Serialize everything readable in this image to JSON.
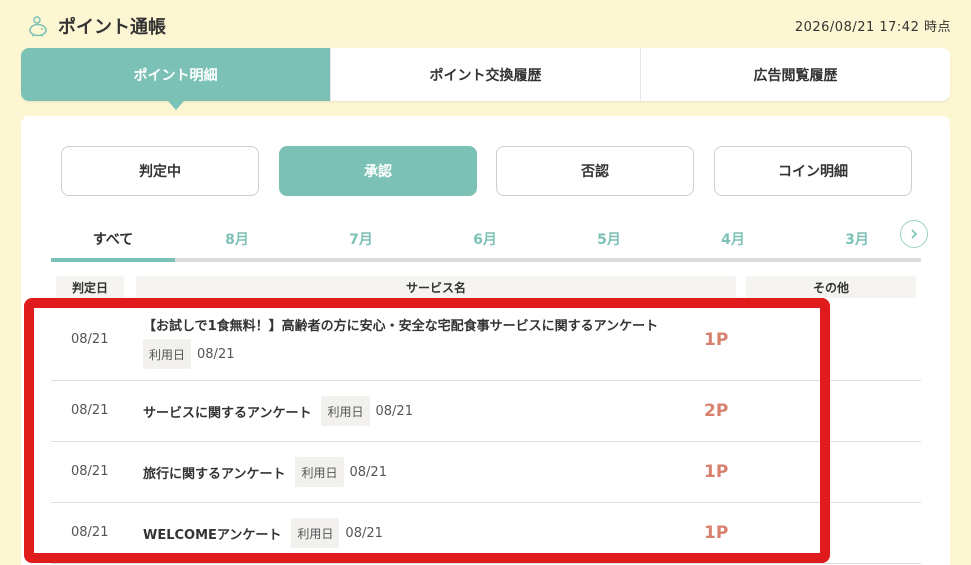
{
  "header": {
    "title": "ポイント通帳",
    "icon": "piggy-bank-icon",
    "timestamp": "2026/08/21 17:42 時点"
  },
  "main_tabs": [
    {
      "label": "ポイント明細",
      "active": true
    },
    {
      "label": "ポイント交換履歴",
      "active": false
    },
    {
      "label": "広告閲覧履歴",
      "active": false
    }
  ],
  "filters": [
    {
      "label": "判定中",
      "active": false
    },
    {
      "label": "承認",
      "active": true
    },
    {
      "label": "否認",
      "active": false
    },
    {
      "label": "コイン明細",
      "active": false
    }
  ],
  "months": [
    {
      "label": "すべて",
      "active": true
    },
    {
      "label": "8月",
      "active": false
    },
    {
      "label": "7月",
      "active": false
    },
    {
      "label": "6月",
      "active": false
    },
    {
      "label": "5月",
      "active": false
    },
    {
      "label": "4月",
      "active": false
    },
    {
      "label": "3月",
      "active": false
    }
  ],
  "table": {
    "headers": [
      "判定日",
      "サービス名",
      "その他"
    ],
    "use_date_label": "利用日",
    "rows": [
      {
        "date": "08/21",
        "service": "【お試しで1食無料！】高齢者の方に安心・安全な宅配食事サービスに関するアンケート",
        "use_date": "08/21",
        "points": "1P"
      },
      {
        "date": "08/21",
        "service": "サービスに関するアンケート",
        "use_date": "08/21",
        "points": "2P"
      },
      {
        "date": "08/21",
        "service": "旅行に関するアンケート",
        "use_date": "08/21",
        "points": "1P"
      },
      {
        "date": "08/21",
        "service": "WELCOMEアンケート",
        "use_date": "08/21",
        "points": "1P"
      }
    ]
  },
  "colors": {
    "accent": "#7cc1b6",
    "points": "#d8816f",
    "highlight": "#e01b1b",
    "background": "#fdf6d3"
  }
}
